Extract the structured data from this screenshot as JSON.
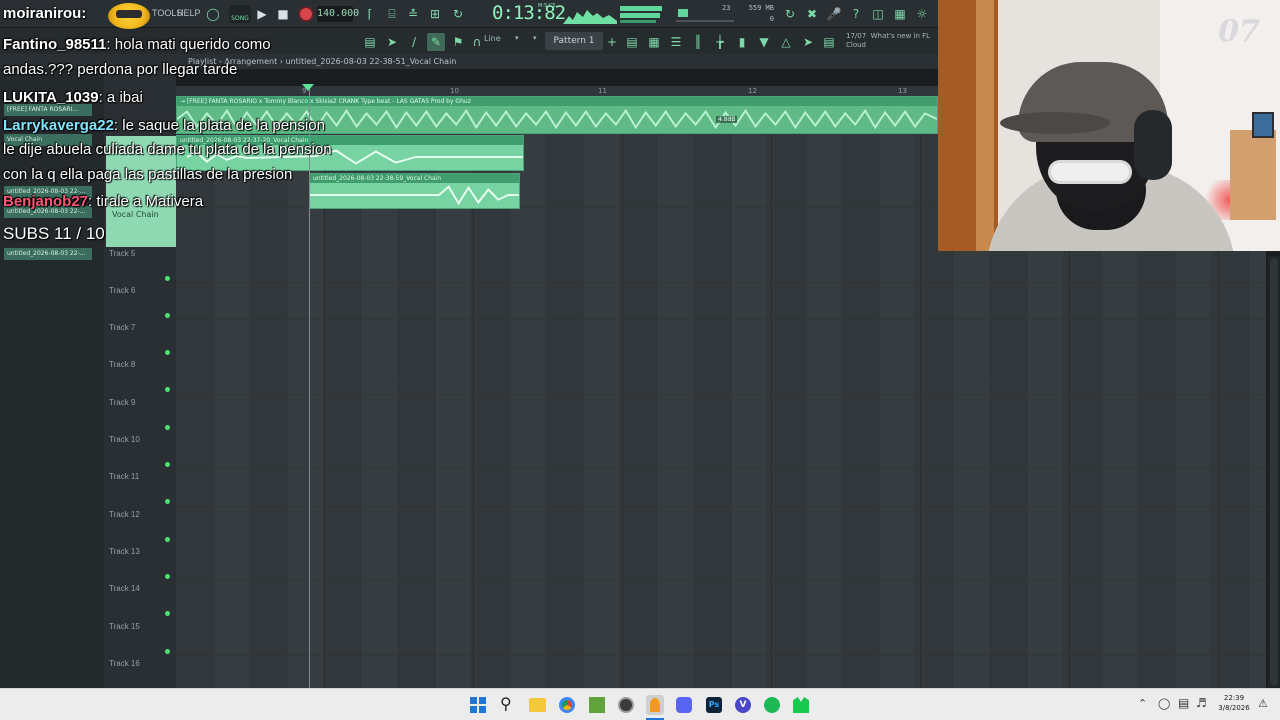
{
  "app": {
    "menu": [
      "TOOLS",
      "HELP"
    ],
    "song_mode_label": "SONG",
    "tempo": "140.000",
    "time": "0:13:82",
    "time_unit": "M:S:CS",
    "memory": "559 MB",
    "cpu_number": "23",
    "polyphony": "0",
    "snap_label": "Line",
    "pattern": "Pattern 1",
    "news_date": "17/07",
    "news_text": "What's new in FL Cloud"
  },
  "playlist": {
    "title": "Playlist - Arrangement › untitled_2026-08-03 22-38-51_Vocal Chain",
    "ruler": [
      "9",
      "10",
      "11",
      "12",
      "13"
    ],
    "clips": [
      {
        "title": "→ [FREE] FANTA ROSARIO x Tommy Blanco x Skisia2 CRANK Type beat - LAS GATAS Prod by Ghuz"
      },
      {
        "title": "untitled_2026-08-03 22-37-20_Vocal Chain"
      },
      {
        "title": "untitled_2026-08-03 22-38-59_Vocal Chain"
      }
    ],
    "gain_label": "4.8dB",
    "first_track_label": "Vocal Chain",
    "tracks": [
      "Track 5",
      "Track 6",
      "Track 7",
      "Track 8",
      "Track 9",
      "Track 10",
      "Track 11",
      "Track 12",
      "Track 13",
      "Track 14",
      "Track 15",
      "Track 16"
    ]
  },
  "browser": {
    "items": [
      "[FREE] FANTA ROSARI...",
      "Vocal Chain",
      "untitled_2026-08-03 22-...",
      "untitled_2026-08-03 22-...",
      "untitled_2026-08-03 22-..."
    ]
  },
  "overlay": {
    "streamer": "moiranirou",
    "subs": "SUBS 11 / 10",
    "chat": [
      {
        "user": "Fantino_98511",
        "user_color": "#ffffff",
        "message": ": hola mati querido como"
      },
      {
        "user": "",
        "user_color": "#ffffff",
        "message": "andas.??? perdona por llegar tarde"
      },
      {
        "user": "LUKITA_1039",
        "user_color": "#ffffff",
        "message": ": a ibai"
      },
      {
        "user": "Larrykaverga22",
        "user_color": "#7fe6ff",
        "message": ": le saque la plata de la pension"
      },
      {
        "user": "",
        "user_color": "#ffffff",
        "message": "le dije abuela culiada dame tu plata de la pension"
      },
      {
        "user": "",
        "user_color": "#ffffff",
        "message": "con la q ella paga las pastillas de la presion"
      },
      {
        "user": "Benjanob27",
        "user_color": "#ff5577",
        "message": ": tirale a Mativera"
      }
    ]
  },
  "taskbar": {
    "time": "22:39",
    "date": "3/8/2026",
    "apps": [
      "windows-start",
      "search",
      "file-explorer",
      "chrome",
      "minecraft",
      "obs",
      "fl-studio",
      "discord",
      "photoshop",
      "vencord",
      "spotify",
      "ableton"
    ]
  },
  "colors": {
    "accent": "#77d4a2",
    "grid": "#363c40",
    "toolbar": "#2a2f33"
  }
}
